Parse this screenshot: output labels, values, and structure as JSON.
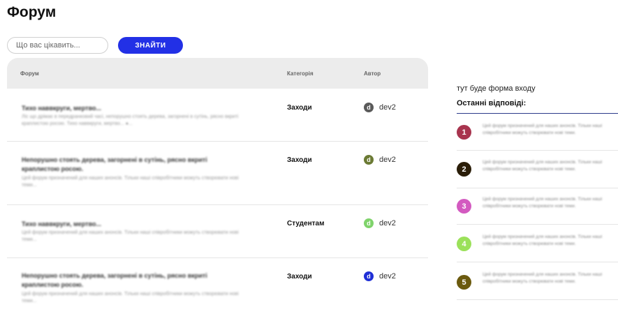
{
  "page": {
    "title": "Форум"
  },
  "search": {
    "placeholder": "Що вас цікавить...",
    "button_label": "ЗНАЙТИ"
  },
  "table": {
    "headers": {
      "forum": "Форум",
      "category": "Категорія",
      "author": "Автор"
    },
    "rows": [
      {
        "title": "Тихо наввкруги, мертво...",
        "description": "Ліс що дрімає в передранковий часі, непорушно стоять дерева, загорнені в сутінь, рясно вкриті краплистою росою. Тихо наввкруги, мертво... ●...",
        "category": "Заходи",
        "author": "dev2",
        "avatar_letter": "d",
        "avatar_color": "#5a5a5a"
      },
      {
        "title": "Непорушно стоять дерева, загорнені в сутінь, рясно вкриті краплистою росою.",
        "description": "Цей форум призначений для наших анонсів. Тільки наші співробітники можуть створювати нові теми...",
        "category": "Заходи",
        "author": "dev2",
        "avatar_letter": "d",
        "avatar_color": "#6b7a34"
      },
      {
        "title": "Тихо наввкруги, мертво...",
        "description": "Цей форум призначений для наших анонсів. Тільки наші співробітники можуть створювати нові теми...",
        "category": "Студентам",
        "author": "dev2",
        "avatar_letter": "d",
        "avatar_color": "#7fd36b"
      },
      {
        "title": "Непорушно стоять дерева, загорнені в сутінь, рясно вкриті краплистою росою.",
        "description": "Цей форум призначений для наших анонсів. Тільки наші співробітники можуть створювати нові теми...",
        "category": "Заходи",
        "author": "dev2",
        "avatar_letter": "d",
        "avatar_color": "#1f2fd6"
      }
    ]
  },
  "sidebar": {
    "login_placeholder": "тут буде форма входу",
    "recent_title": "Останні відповіді:",
    "replies": [
      {
        "number": "1",
        "color": "#a8344e",
        "text": "Цей форум призначений для наших анонсів. Тільки наші співробітники можуть створювати нові теми."
      },
      {
        "number": "2",
        "color": "#2a1d08",
        "text": "Цей форум призначений для наших анонсів. Тільки наші співробітники можуть створювати нові теми."
      },
      {
        "number": "3",
        "color": "#d35ac0",
        "text": "Цей форум призначений для наших анонсів. Тільки наші співробітники можуть створювати нові теми."
      },
      {
        "number": "4",
        "color": "#9be15a",
        "text": "Цей форум призначений для наших анонсів. Тільки наші співробітники можуть створювати нові теми."
      },
      {
        "number": "5",
        "color": "#6b5a0e",
        "text": "Цей форум призначений для наших анонсів. Тільки наші співробітники можуть створювати нові теми."
      }
    ]
  }
}
